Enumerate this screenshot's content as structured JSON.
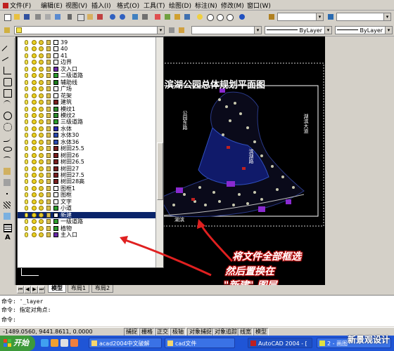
{
  "menu": [
    "文件(F)",
    "编辑(E)",
    "视图(V)",
    "插入(I)",
    "格式(O)",
    "工具(T)",
    "绘图(D)",
    "标注(N)",
    "修改(M)",
    "窗口(W)"
  ],
  "properties_toolbar": {
    "linetype": "ByLayer",
    "lineweight": "ByLayer"
  },
  "layers": [
    {
      "name": "39",
      "color": "#ffffff"
    },
    {
      "name": "40",
      "color": "#ffffff"
    },
    {
      "name": "41",
      "color": "#ffffff"
    },
    {
      "name": "边界",
      "color": "#ffffff"
    },
    {
      "name": "次入口",
      "color": "#6a2aa8"
    },
    {
      "name": "二级道路",
      "color": "#2e9e2e"
    },
    {
      "name": "辅助线",
      "color": "#1a7a1a"
    },
    {
      "name": "广场",
      "color": "#ffffff"
    },
    {
      "name": "花架",
      "color": "#ffffff"
    },
    {
      "name": "建筑",
      "color": "#7a2020"
    },
    {
      "name": "模纹1",
      "color": "#2e8e2e"
    },
    {
      "name": "模纹2",
      "color": "#2e8e2e"
    },
    {
      "name": "三级道路",
      "color": "#2e9e2e"
    },
    {
      "name": "水体",
      "color": "#2a2ab0"
    },
    {
      "name": "水体30",
      "color": "#2a4ab0"
    },
    {
      "name": "水体36",
      "color": "#2a4ab0"
    },
    {
      "name": "树田25.5",
      "color": "#7a2020"
    },
    {
      "name": "树田26",
      "color": "#7a2020"
    },
    {
      "name": "树田26.5",
      "color": "#7a2020"
    },
    {
      "name": "树田27",
      "color": "#7a2020"
    },
    {
      "name": "树田27.5",
      "color": "#7a2020"
    },
    {
      "name": "树田28高",
      "color": "#7a2020"
    },
    {
      "name": "图框1",
      "color": "#ffffff"
    },
    {
      "name": "图框",
      "color": "#ffffff"
    },
    {
      "name": "文字",
      "color": "#ffffff"
    },
    {
      "name": "小道",
      "color": "#2e9e2e"
    },
    {
      "name": "新建",
      "color": "#ffffff",
      "selected": true
    },
    {
      "name": "一级道路",
      "color": "#2e9e2e"
    },
    {
      "name": "植物",
      "color": "#2e9e2e"
    },
    {
      "name": "主入口",
      "color": "#6a2aa8"
    }
  ],
  "drawing": {
    "title": "滨湖公园总体规划平面图",
    "labels": [
      "公园东路",
      "湖滨大道",
      "滨湖路",
      "湖滨"
    ]
  },
  "tabs": [
    "模型",
    "布局1",
    "布局2"
  ],
  "command_lines": [
    "命令: '_layer",
    "命令: 指定对角点:",
    "命令:"
  ],
  "status": {
    "coords": "-1489.0560, 9441.8611, 0.0000",
    "buttons": [
      "捕捉",
      "栅格",
      "正交",
      "极轴",
      "对象捕捉",
      "对象追踪",
      "线宽",
      "模型"
    ]
  },
  "taskbar": {
    "start": "开始",
    "tasks": [
      "acad2004中文破解",
      "cad文件",
      "AutoCAD 2004 - [",
      "2 - 画图"
    ]
  },
  "annotation": {
    "line1": "将文件全部框选",
    "line2": "然后置换在",
    "line3": "\"新建\" 图层"
  },
  "watermark": "新景观设计"
}
